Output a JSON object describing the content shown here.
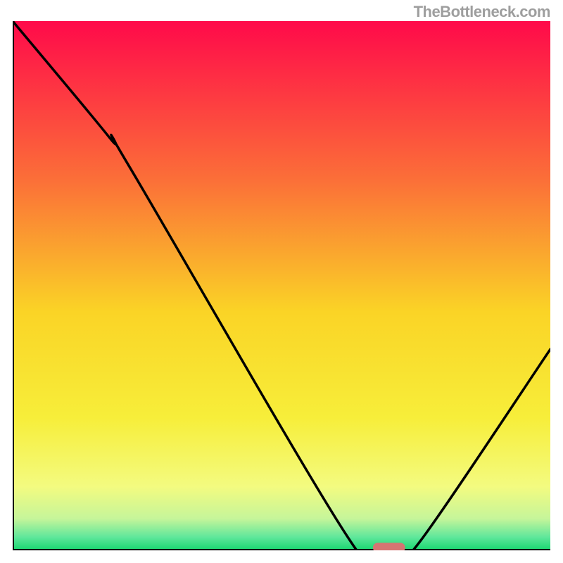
{
  "watermark": "TheBottleneck.com",
  "chart_data": {
    "type": "line",
    "title": "",
    "xlabel": "",
    "ylabel": "",
    "xlim": [
      0,
      100
    ],
    "ylim": [
      0,
      100
    ],
    "grid": false,
    "axes_visible": {
      "left": true,
      "bottom": true,
      "right": false,
      "top": false
    },
    "tick_labels": {
      "x": [],
      "y": []
    },
    "background_gradient": {
      "stops": [
        {
          "pos": 0.0,
          "color": "#ff0a4a"
        },
        {
          "pos": 0.3,
          "color": "#fb6f38"
        },
        {
          "pos": 0.55,
          "color": "#fad426"
        },
        {
          "pos": 0.75,
          "color": "#f7ee3a"
        },
        {
          "pos": 0.88,
          "color": "#f3fb80"
        },
        {
          "pos": 0.94,
          "color": "#c6f59a"
        },
        {
          "pos": 0.975,
          "color": "#5fe79b"
        },
        {
          "pos": 1.0,
          "color": "#17d66e"
        }
      ]
    },
    "series": [
      {
        "name": "bottleneck-curve",
        "color": "#000000",
        "x": [
          0,
          18,
          22,
          62,
          68,
          72,
          76,
          100
        ],
        "values": [
          100,
          78,
          72,
          3,
          0,
          0,
          2,
          38
        ]
      }
    ],
    "marker": {
      "name": "selected-point",
      "x_range": [
        67,
        73
      ],
      "y": 0.5,
      "color": "#d57572"
    }
  }
}
